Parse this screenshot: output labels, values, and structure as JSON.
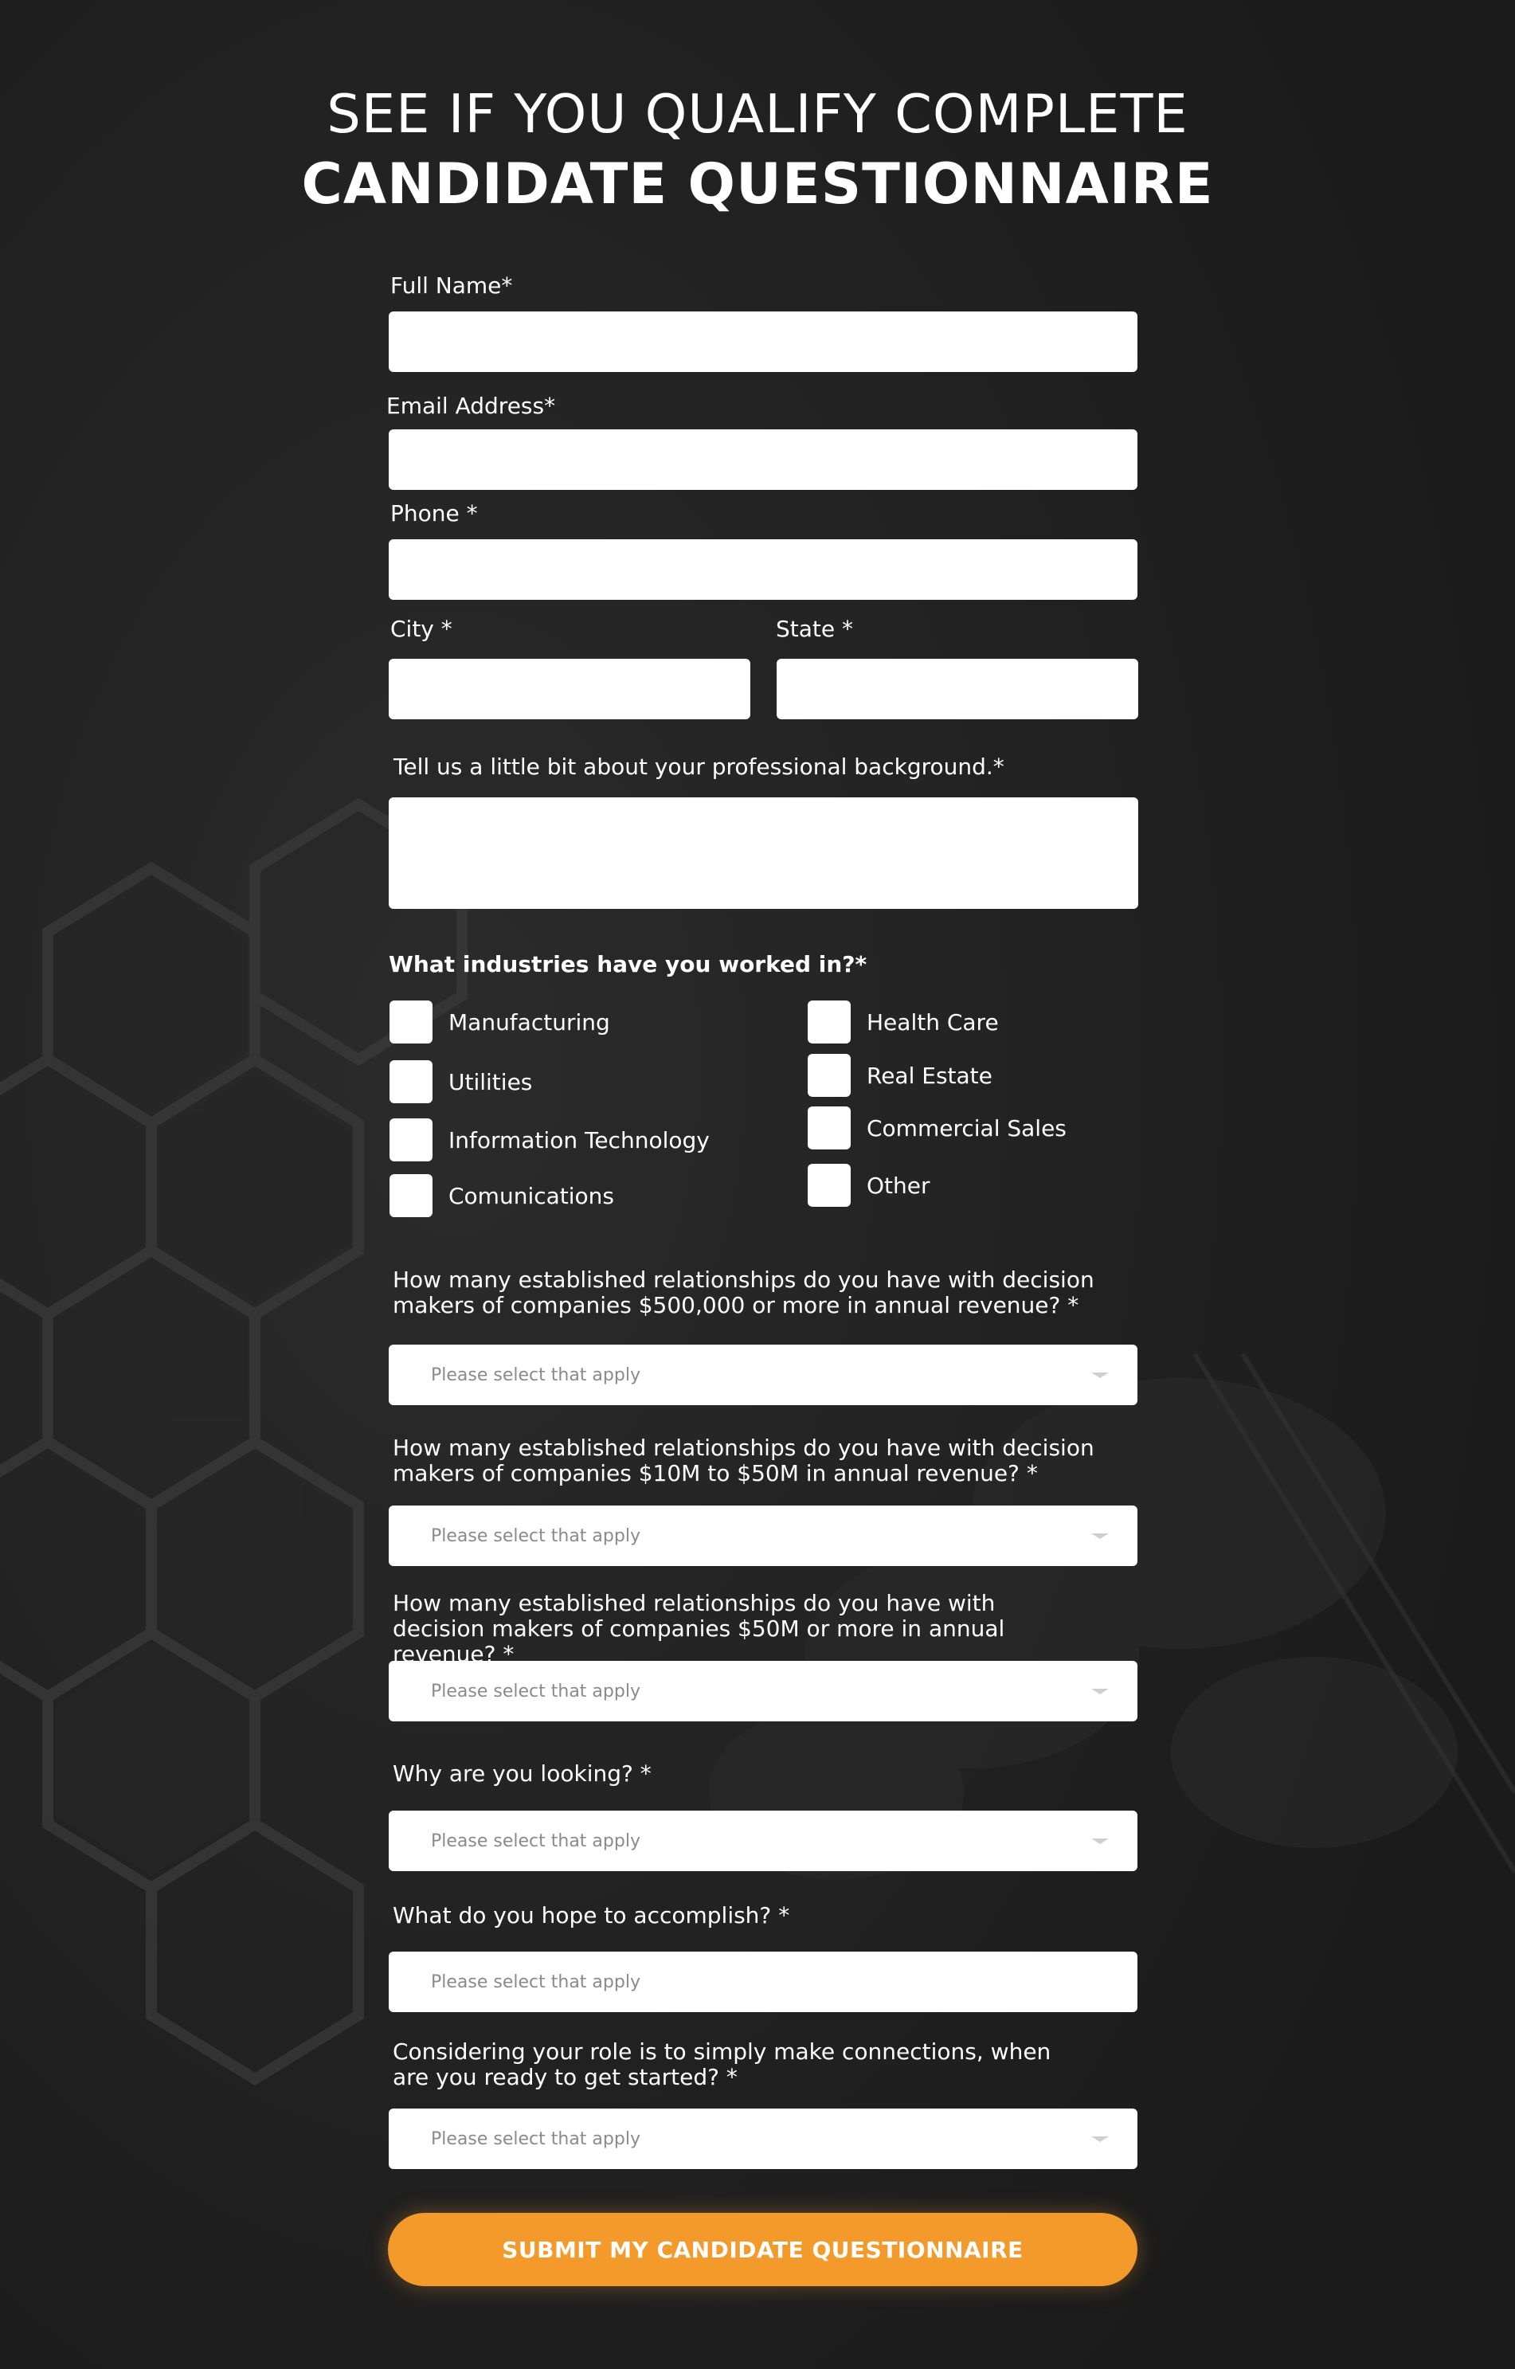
{
  "header": {
    "line1": "SEE IF YOU QUALIFY COMPLETE",
    "line2": "CANDIDATE QUESTIONNAIRE"
  },
  "form": {
    "full_name_label": "Full Name*",
    "email_label": "Email Address*",
    "phone_label": "Phone *",
    "city_label": "City *",
    "state_label": "State *",
    "background_label": "Tell us a little bit about your professional background.*",
    "industries_label": "What industries have you worked in?*",
    "industries": [
      "Manufacturing",
      "Utilities",
      "Information Technology",
      "Comunications",
      "Health Care",
      "Real Estate",
      "Commercial Sales",
      "Other"
    ],
    "q1_label": "How many established relationships do you have with decision makers of companies $500,000 or more in annual revenue? *",
    "q2_label": "How many established relationships do you have with decision makers of companies $10M to $50M in annual revenue? *",
    "q3_label": "How many established relationships do you have with decision makers of companies $50M or more in annual revenue? *",
    "q4_label": "Why are you looking? *",
    "q5_label": "What do you hope to accomplish? *",
    "q6_label": "Considering your role is to simply make connections, when are you ready to get started? *",
    "select_placeholder": "Please select that apply",
    "submit_label": "SUBMIT MY CANDIDATE QUESTIONNAIRE"
  },
  "colors": {
    "background": "#1d1d1d",
    "accent": "#f39a2b",
    "field": "#ffffff",
    "placeholder": "#8a8a8a"
  }
}
